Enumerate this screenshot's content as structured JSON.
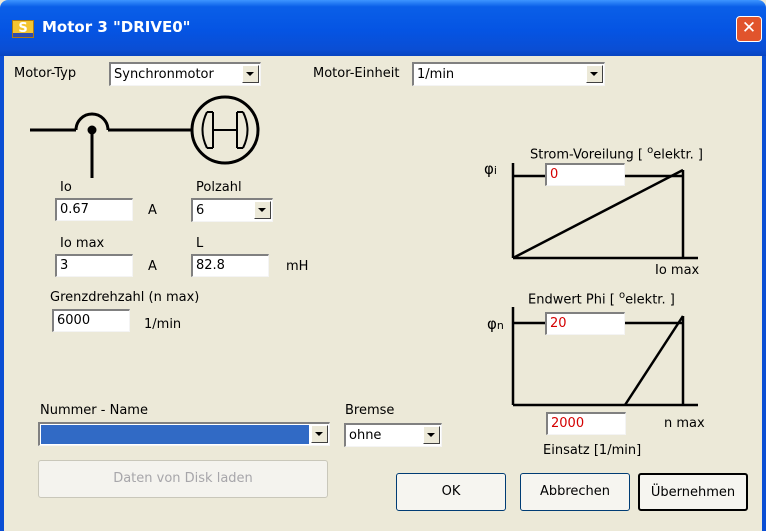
{
  "window": {
    "title": "Motor 3 \"DRIVE0\"",
    "app_icon_letter": "S",
    "close_glyph": "✕",
    "accent_color": "#0554e3"
  },
  "motor": {
    "type_label": "Motor-Typ",
    "type_value": "Synchronmotor",
    "unit_label": "Motor-Einheit",
    "unit_value": "1/min"
  },
  "params": {
    "io_label": "Io",
    "io_value": "0.67",
    "io_unit": "A",
    "poles_label": "Polzahl",
    "poles_value": "6",
    "iomax_label": "Io max",
    "iomax_value": "3",
    "iomax_unit": "A",
    "l_label": "L",
    "l_value": "82.8",
    "l_unit": "mH",
    "nmax_label": "Grenzdrehzahl (n max)",
    "nmax_value": "6000",
    "nmax_unit": "1/min"
  },
  "graph_current": {
    "phi_symbol": "φ",
    "phi_sub": "i",
    "title_prefix": "Strom-Voreilung [ ",
    "title_deg": "o",
    "title_suffix": "elektr. ]",
    "value": "0",
    "axis_label": "Io max"
  },
  "graph_speed": {
    "phi_symbol": "φ",
    "phi_sub": "n",
    "title_prefix": "Endwert Phi [ ",
    "title_deg": "o",
    "title_suffix": "elektr. ]",
    "value": "20",
    "start_value": "2000",
    "axis_label": "n max",
    "start_label": "Einsatz  [1/min]"
  },
  "selection": {
    "name_label": "Nummer - Name",
    "name_value": "",
    "brake_label": "Bremse",
    "brake_value": "ohne"
  },
  "buttons": {
    "load_disk": "Daten von Disk laden",
    "ok": "OK",
    "cancel": "Abbrechen",
    "apply": "Übernehmen"
  }
}
